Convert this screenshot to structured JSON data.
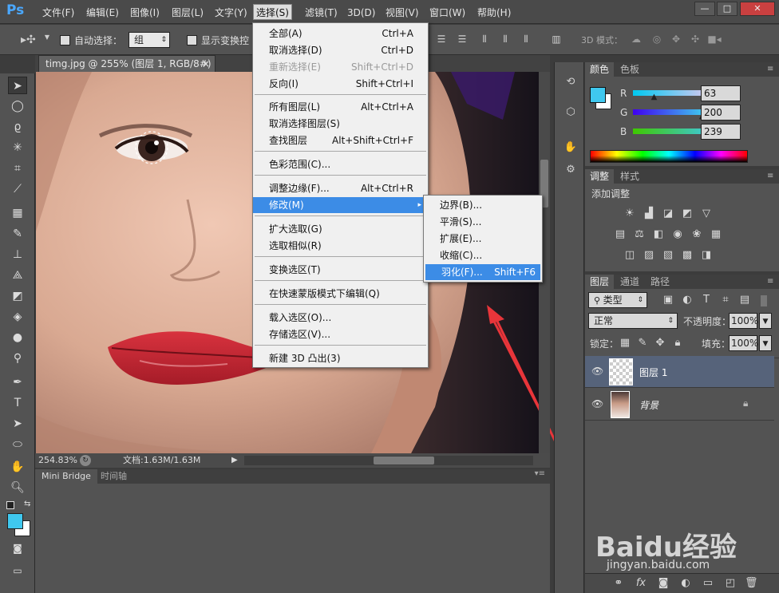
{
  "app": {
    "logo": "Ps"
  },
  "menubar": {
    "items": [
      "文件(F)",
      "编辑(E)",
      "图像(I)",
      "图层(L)",
      "文字(Y)",
      "选择(S)",
      "滤镜(T)",
      "3D(D)",
      "视图(V)",
      "窗口(W)",
      "帮助(H)"
    ],
    "window_buttons": [
      "—",
      "□",
      "✕"
    ]
  },
  "options": {
    "auto_select": "自动选择：",
    "auto_select_value": "组",
    "show_transform": "显示变换控",
    "mode3d": "3D 模式："
  },
  "document": {
    "tab_title": "timg.jpg @ 255% (图层 1, RGB/8#) *",
    "close": "×",
    "zoom": "254.83%",
    "doc_info": "文档:1.63M/1.63M"
  },
  "bridge": {
    "tab1": "Mini Bridge",
    "tab2": "时间轴"
  },
  "select_menu": {
    "items": [
      {
        "label": "全部(A)",
        "shortcut": "Ctrl+A"
      },
      {
        "label": "取消选择(D)",
        "shortcut": "Ctrl+D"
      },
      {
        "label": "重新选择(E)",
        "shortcut": "Shift+Ctrl+D"
      },
      {
        "label": "反向(I)",
        "shortcut": "Shift+Ctrl+I"
      },
      {
        "label": "所有图层(L)",
        "shortcut": "Alt+Ctrl+A"
      },
      {
        "label": "取消选择图层(S)",
        "shortcut": ""
      },
      {
        "label": "查找图层",
        "shortcut": "Alt+Shift+Ctrl+F"
      },
      {
        "label": "色彩范围(C)...",
        "shortcut": ""
      },
      {
        "label": "调整边缘(F)...",
        "shortcut": "Alt+Ctrl+R"
      },
      {
        "label": "修改(M)",
        "shortcut": "▸"
      },
      {
        "label": "扩大选取(G)",
        "shortcut": ""
      },
      {
        "label": "选取相似(R)",
        "shortcut": ""
      },
      {
        "label": "变换选区(T)",
        "shortcut": ""
      },
      {
        "label": "在快速蒙版模式下编辑(Q)",
        "shortcut": ""
      },
      {
        "label": "载入选区(O)...",
        "shortcut": ""
      },
      {
        "label": "存储选区(V)...",
        "shortcut": ""
      },
      {
        "label": "新建 3D 凸出(3)",
        "shortcut": ""
      }
    ]
  },
  "modify_submenu": {
    "items": [
      {
        "label": "边界(B)...",
        "shortcut": ""
      },
      {
        "label": "平滑(S)...",
        "shortcut": ""
      },
      {
        "label": "扩展(E)...",
        "shortcut": ""
      },
      {
        "label": "收缩(C)...",
        "shortcut": ""
      },
      {
        "label": "羽化(F)...",
        "shortcut": "Shift+F6"
      }
    ]
  },
  "color_panel": {
    "tabs": [
      "颜色",
      "色板"
    ],
    "r_label": "R",
    "g_label": "G",
    "b_label": "B",
    "r": "63",
    "g": "200",
    "b": "239",
    "fg_color": "#3fc8ef"
  },
  "adjust_panel": {
    "tabs": [
      "调整",
      "样式"
    ],
    "title": "添加调整"
  },
  "layers_panel": {
    "tabs": [
      "图层",
      "通道",
      "路径"
    ],
    "filter": "类型",
    "blend": "正常",
    "opacity_label": "不透明度：",
    "opacity": "100%",
    "lock_label": "锁定：",
    "fill_label": "填充：",
    "fill": "100%",
    "layers": [
      {
        "name": "图层 1"
      },
      {
        "name": "背景"
      }
    ]
  },
  "watermark": {
    "brand": "Baidu经验",
    "url": "jingyan.baidu.com"
  },
  "colors": {
    "accent": "#3c8ce6",
    "arrow": "#e8353a"
  }
}
